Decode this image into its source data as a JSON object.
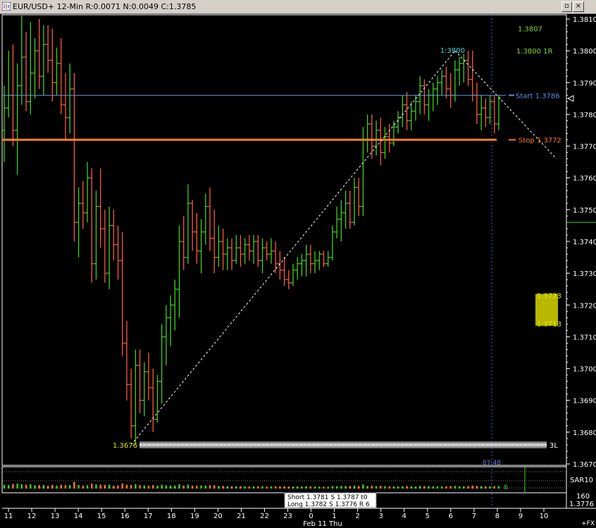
{
  "window": {
    "title": "EUR/USD+ 12-Min R:0.0071 N:0.0049 C:1.3785",
    "icon": "chart-icon",
    "controls": [
      {
        "name": "restore-button",
        "glyph": "▫"
      },
      {
        "name": "close-button",
        "glyph": "×"
      }
    ]
  },
  "chart_data": {
    "type": "bar",
    "style": "OHLC price bars, green = up, red = down",
    "symbol": "EUR/USD+",
    "interval": "12-Min",
    "header_stats": {
      "R": "0.0071",
      "N": "0.0049",
      "C": "1.3785"
    },
    "ylim": [
      1.3668,
      1.3812
    ],
    "y_ticks": [
      "1.3810",
      "1.3800",
      "1.3790",
      "1.3780",
      "1.3770",
      "1.3760",
      "1.3750",
      "1.3740",
      "1.3730",
      "1.3720",
      "1.3710",
      "1.3700",
      "1.3690",
      "1.3680",
      "1.3670"
    ],
    "x_ticks": [
      "11",
      "12",
      "13",
      "14",
      "15",
      "16",
      "17",
      "18",
      "19",
      "20",
      "21",
      "22",
      "23",
      "0",
      "1",
      "2",
      "3",
      "4",
      "5",
      "6",
      "7",
      "8",
      "9",
      "10"
    ],
    "x_date_label": "Feb 11 Thu",
    "bars": [
      {
        "o": 1.3775,
        "h": 1.3789,
        "l": 1.3765,
        "c": 1.3782
      },
      {
        "o": 1.3782,
        "h": 1.38,
        "l": 1.3779,
        "c": 1.3786
      },
      {
        "o": 1.3786,
        "h": 1.3802,
        "l": 1.377,
        "c": 1.3775
      },
      {
        "o": 1.3775,
        "h": 1.3796,
        "l": 1.3761,
        "c": 1.3789
      },
      {
        "o": 1.3789,
        "h": 1.3811,
        "l": 1.3783,
        "c": 1.3798
      },
      {
        "o": 1.3798,
        "h": 1.3806,
        "l": 1.3781,
        "c": 1.3784
      },
      {
        "o": 1.3784,
        "h": 1.3809,
        "l": 1.378,
        "c": 1.3793
      },
      {
        "o": 1.3793,
        "h": 1.3804,
        "l": 1.3785,
        "c": 1.38
      },
      {
        "o": 1.38,
        "h": 1.381,
        "l": 1.3788,
        "c": 1.3792
      },
      {
        "o": 1.3792,
        "h": 1.3808,
        "l": 1.3786,
        "c": 1.3802
      },
      {
        "o": 1.3802,
        "h": 1.3808,
        "l": 1.3793,
        "c": 1.3797
      },
      {
        "o": 1.3797,
        "h": 1.3807,
        "l": 1.3784,
        "c": 1.379
      },
      {
        "o": 1.379,
        "h": 1.3801,
        "l": 1.3786,
        "c": 1.3796
      },
      {
        "o": 1.3796,
        "h": 1.3804,
        "l": 1.378,
        "c": 1.3783
      },
      {
        "o": 1.3783,
        "h": 1.3793,
        "l": 1.3772,
        "c": 1.3779
      },
      {
        "o": 1.3779,
        "h": 1.3796,
        "l": 1.3774,
        "c": 1.3788
      },
      {
        "o": 1.3788,
        "h": 1.3793,
        "l": 1.374,
        "c": 1.3746
      },
      {
        "o": 1.3746,
        "h": 1.3757,
        "l": 1.3735,
        "c": 1.3752
      },
      {
        "o": 1.3752,
        "h": 1.3759,
        "l": 1.3744,
        "c": 1.3749
      },
      {
        "o": 1.3749,
        "h": 1.3765,
        "l": 1.3746,
        "c": 1.376
      },
      {
        "o": 1.376,
        "h": 1.3763,
        "l": 1.3727,
        "c": 1.3733
      },
      {
        "o": 1.3733,
        "h": 1.3756,
        "l": 1.3728,
        "c": 1.3751
      },
      {
        "o": 1.3751,
        "h": 1.3763,
        "l": 1.3738,
        "c": 1.3744
      },
      {
        "o": 1.3744,
        "h": 1.375,
        "l": 1.3727,
        "c": 1.373
      },
      {
        "o": 1.373,
        "h": 1.3751,
        "l": 1.3725,
        "c": 1.3745
      },
      {
        "o": 1.3745,
        "h": 1.375,
        "l": 1.3734,
        "c": 1.3739
      },
      {
        "o": 1.3739,
        "h": 1.3745,
        "l": 1.3728,
        "c": 1.3734
      },
      {
        "o": 1.3734,
        "h": 1.3743,
        "l": 1.3704,
        "c": 1.3708
      },
      {
        "o": 1.3708,
        "h": 1.3715,
        "l": 1.369,
        "c": 1.3695
      },
      {
        "o": 1.3695,
        "h": 1.37,
        "l": 1.3678,
        "c": 1.3682
      },
      {
        "o": 1.3682,
        "h": 1.3706,
        "l": 1.3676,
        "c": 1.3701
      },
      {
        "o": 1.3701,
        "h": 1.3706,
        "l": 1.3686,
        "c": 1.369
      },
      {
        "o": 1.369,
        "h": 1.3702,
        "l": 1.3685,
        "c": 1.3699
      },
      {
        "o": 1.3699,
        "h": 1.3705,
        "l": 1.369,
        "c": 1.3694
      },
      {
        "o": 1.3694,
        "h": 1.37,
        "l": 1.368,
        "c": 1.3684
      },
      {
        "o": 1.3684,
        "h": 1.3698,
        "l": 1.3683,
        "c": 1.3696
      },
      {
        "o": 1.3696,
        "h": 1.3714,
        "l": 1.3689,
        "c": 1.371
      },
      {
        "o": 1.371,
        "h": 1.372,
        "l": 1.3701,
        "c": 1.3716
      },
      {
        "o": 1.3716,
        "h": 1.3723,
        "l": 1.3707,
        "c": 1.372
      },
      {
        "o": 1.372,
        "h": 1.3728,
        "l": 1.3712,
        "c": 1.3725
      },
      {
        "o": 1.3725,
        "h": 1.3745,
        "l": 1.3716,
        "c": 1.374
      },
      {
        "o": 1.374,
        "h": 1.3748,
        "l": 1.3731,
        "c": 1.3735
      },
      {
        "o": 1.3735,
        "h": 1.3758,
        "l": 1.3733,
        "c": 1.3752
      },
      {
        "o": 1.3752,
        "h": 1.3753,
        "l": 1.3737,
        "c": 1.3743
      },
      {
        "o": 1.3743,
        "h": 1.3749,
        "l": 1.3733,
        "c": 1.3737
      },
      {
        "o": 1.3737,
        "h": 1.3747,
        "l": 1.373,
        "c": 1.3743
      },
      {
        "o": 1.3743,
        "h": 1.3755,
        "l": 1.3739,
        "c": 1.3751
      },
      {
        "o": 1.3751,
        "h": 1.3757,
        "l": 1.3737,
        "c": 1.3741
      },
      {
        "o": 1.3741,
        "h": 1.375,
        "l": 1.373,
        "c": 1.3735
      },
      {
        "o": 1.3735,
        "h": 1.3745,
        "l": 1.3732,
        "c": 1.374
      },
      {
        "o": 1.374,
        "h": 1.3744,
        "l": 1.3731,
        "c": 1.3736
      },
      {
        "o": 1.3736,
        "h": 1.3741,
        "l": 1.3731,
        "c": 1.3738
      },
      {
        "o": 1.3738,
        "h": 1.3741,
        "l": 1.3731,
        "c": 1.3734
      },
      {
        "o": 1.3734,
        "h": 1.3742,
        "l": 1.3733,
        "c": 1.3738
      },
      {
        "o": 1.3738,
        "h": 1.3742,
        "l": 1.3732,
        "c": 1.3736
      },
      {
        "o": 1.3736,
        "h": 1.3741,
        "l": 1.3733,
        "c": 1.3739
      },
      {
        "o": 1.3739,
        "h": 1.3742,
        "l": 1.3734,
        "c": 1.3737
      },
      {
        "o": 1.3737,
        "h": 1.3742,
        "l": 1.3733,
        "c": 1.374
      },
      {
        "o": 1.374,
        "h": 1.3742,
        "l": 1.3732,
        "c": 1.3734
      },
      {
        "o": 1.3734,
        "h": 1.3741,
        "l": 1.373,
        "c": 1.3738
      },
      {
        "o": 1.3738,
        "h": 1.374,
        "l": 1.3734,
        "c": 1.3736
      },
      {
        "o": 1.3736,
        "h": 1.3741,
        "l": 1.3733,
        "c": 1.3737
      },
      {
        "o": 1.3737,
        "h": 1.374,
        "l": 1.373,
        "c": 1.3733
      },
      {
        "o": 1.3733,
        "h": 1.3737,
        "l": 1.3728,
        "c": 1.3731
      },
      {
        "o": 1.3731,
        "h": 1.3735,
        "l": 1.3726,
        "c": 1.3728
      },
      {
        "o": 1.3728,
        "h": 1.3731,
        "l": 1.3725,
        "c": 1.3727
      },
      {
        "o": 1.3727,
        "h": 1.3733,
        "l": 1.3726,
        "c": 1.3731
      },
      {
        "o": 1.3731,
        "h": 1.3735,
        "l": 1.3728,
        "c": 1.3733
      },
      {
        "o": 1.3733,
        "h": 1.3736,
        "l": 1.3729,
        "c": 1.3734
      },
      {
        "o": 1.3734,
        "h": 1.3739,
        "l": 1.3729,
        "c": 1.3736
      },
      {
        "o": 1.3736,
        "h": 1.3739,
        "l": 1.373,
        "c": 1.3733
      },
      {
        "o": 1.3733,
        "h": 1.3737,
        "l": 1.373,
        "c": 1.3734
      },
      {
        "o": 1.3734,
        "h": 1.3737,
        "l": 1.3731,
        "c": 1.3736
      },
      {
        "o": 1.3736,
        "h": 1.3737,
        "l": 1.3732,
        "c": 1.3733
      },
      {
        "o": 1.3733,
        "h": 1.3737,
        "l": 1.3732,
        "c": 1.3735
      },
      {
        "o": 1.3735,
        "h": 1.3745,
        "l": 1.3734,
        "c": 1.3743
      },
      {
        "o": 1.3743,
        "h": 1.3751,
        "l": 1.3741,
        "c": 1.3747
      },
      {
        "o": 1.3747,
        "h": 1.3753,
        "l": 1.374,
        "c": 1.3749
      },
      {
        "o": 1.3749,
        "h": 1.3756,
        "l": 1.3744,
        "c": 1.3752
      },
      {
        "o": 1.3752,
        "h": 1.3756,
        "l": 1.3744,
        "c": 1.3746
      },
      {
        "o": 1.3746,
        "h": 1.376,
        "l": 1.3745,
        "c": 1.3757
      },
      {
        "o": 1.3757,
        "h": 1.376,
        "l": 1.3748,
        "c": 1.3751
      },
      {
        "o": 1.3751,
        "h": 1.3776,
        "l": 1.3748,
        "c": 1.3772
      },
      {
        "o": 1.3772,
        "h": 1.378,
        "l": 1.3768,
        "c": 1.3777
      },
      {
        "o": 1.3777,
        "h": 1.378,
        "l": 1.3766,
        "c": 1.377
      },
      {
        "o": 1.377,
        "h": 1.3778,
        "l": 1.3767,
        "c": 1.3775
      },
      {
        "o": 1.3775,
        "h": 1.3779,
        "l": 1.3764,
        "c": 1.3768
      },
      {
        "o": 1.3768,
        "h": 1.3776,
        "l": 1.3766,
        "c": 1.3773
      },
      {
        "o": 1.3773,
        "h": 1.3777,
        "l": 1.3768,
        "c": 1.3771
      },
      {
        "o": 1.3771,
        "h": 1.3778,
        "l": 1.377,
        "c": 1.3776
      },
      {
        "o": 1.3776,
        "h": 1.3781,
        "l": 1.3774,
        "c": 1.3779
      },
      {
        "o": 1.3779,
        "h": 1.3786,
        "l": 1.3776,
        "c": 1.3783
      },
      {
        "o": 1.3783,
        "h": 1.3787,
        "l": 1.3775,
        "c": 1.3778
      },
      {
        "o": 1.3778,
        "h": 1.3784,
        "l": 1.3775,
        "c": 1.3781
      },
      {
        "o": 1.3781,
        "h": 1.3786,
        "l": 1.3778,
        "c": 1.3784
      },
      {
        "o": 1.3784,
        "h": 1.3792,
        "l": 1.378,
        "c": 1.3789
      },
      {
        "o": 1.3789,
        "h": 1.3791,
        "l": 1.378,
        "c": 1.3783
      },
      {
        "o": 1.3783,
        "h": 1.3788,
        "l": 1.3778,
        "c": 1.3786
      },
      {
        "o": 1.3786,
        "h": 1.379,
        "l": 1.3781,
        "c": 1.3788
      },
      {
        "o": 1.3788,
        "h": 1.3792,
        "l": 1.3783,
        "c": 1.379
      },
      {
        "o": 1.379,
        "h": 1.3794,
        "l": 1.3786,
        "c": 1.3792
      },
      {
        "o": 1.3792,
        "h": 1.3795,
        "l": 1.3785,
        "c": 1.3788
      },
      {
        "o": 1.3788,
        "h": 1.3793,
        "l": 1.3782,
        "c": 1.3786
      },
      {
        "o": 1.3786,
        "h": 1.3797,
        "l": 1.3784,
        "c": 1.3794
      },
      {
        "o": 1.3794,
        "h": 1.3798,
        "l": 1.3789,
        "c": 1.3796
      },
      {
        "o": 1.3796,
        "h": 1.3799,
        "l": 1.379,
        "c": 1.3797
      },
      {
        "o": 1.3797,
        "h": 1.38,
        "l": 1.3789,
        "c": 1.3791
      },
      {
        "o": 1.3791,
        "h": 1.38,
        "l": 1.3784,
        "c": 1.3786
      },
      {
        "o": 1.3786,
        "h": 1.379,
        "l": 1.3777,
        "c": 1.378
      },
      {
        "o": 1.378,
        "h": 1.3786,
        "l": 1.3775,
        "c": 1.3782
      },
      {
        "o": 1.3782,
        "h": 1.3785,
        "l": 1.3776,
        "c": 1.3779
      },
      {
        "o": 1.3779,
        "h": 1.3786,
        "l": 1.3777,
        "c": 1.3784
      },
      {
        "o": 1.3784,
        "h": 1.3786,
        "l": 1.3774,
        "c": 1.3777
      },
      {
        "o": 1.3777,
        "h": 1.3786,
        "l": 1.3775,
        "c": 1.3785
      }
    ],
    "trendlines": [
      {
        "name": "swing-up-line",
        "from": {
          "price": 1.3676
        },
        "to": {
          "price": 1.38
        },
        "style": "dashed",
        "color": "#ffffff"
      },
      {
        "name": "swing-down-projection",
        "from": {
          "price": 1.38
        },
        "to": {
          "price": 1.3766
        },
        "style": "dashed",
        "color": "#ffffff"
      }
    ],
    "hlines": [
      {
        "name": "start-line",
        "price": 1.3786,
        "color": "#5b8fe6",
        "label": "Start 1.3786"
      },
      {
        "name": "stop-line",
        "price": 1.3772,
        "color": "#ff7a1a",
        "label": "Stop 1.3772"
      }
    ],
    "annotations": [
      {
        "name": "high-label",
        "text": "1:3800",
        "color": "#4fd7d7"
      },
      {
        "name": "low-label",
        "text": "1.3676",
        "color": "#e6e600"
      },
      {
        "name": "target-1",
        "text": "1.3807",
        "color": "#7fd62f"
      },
      {
        "name": "target-2",
        "text": "1.3800 1R",
        "color": "#7fd62f"
      },
      {
        "name": "box-top",
        "text": "1.3723",
        "color": "#e6e600"
      },
      {
        "name": "box-bottom",
        "text": "1.3713",
        "color": "#e6e600"
      },
      {
        "name": "low-bar-label",
        "text": "3L",
        "color": "#ffffff"
      },
      {
        "name": "cursor-time",
        "text": "07:48",
        "color": "#6a7fe0"
      }
    ],
    "current_price_marker": "1.3785",
    "indicator": {
      "name": "SAR10",
      "label": "SAR10",
      "marker": "8",
      "values_label": "160",
      "last_price": "1.3776",
      "up_color": "#3fd21a",
      "down_color": "#ff7a1a"
    },
    "info_box": {
      "line1": "Short 1.3781  S 1.3787   t0",
      "line2": "Long 1.3782  S 1.3776  R 6"
    },
    "corner_label": "+FX",
    "colors": {
      "up": "#3fd21a",
      "down": "#ff5a3c",
      "background": "#000000",
      "axis": "#ffffff"
    }
  }
}
